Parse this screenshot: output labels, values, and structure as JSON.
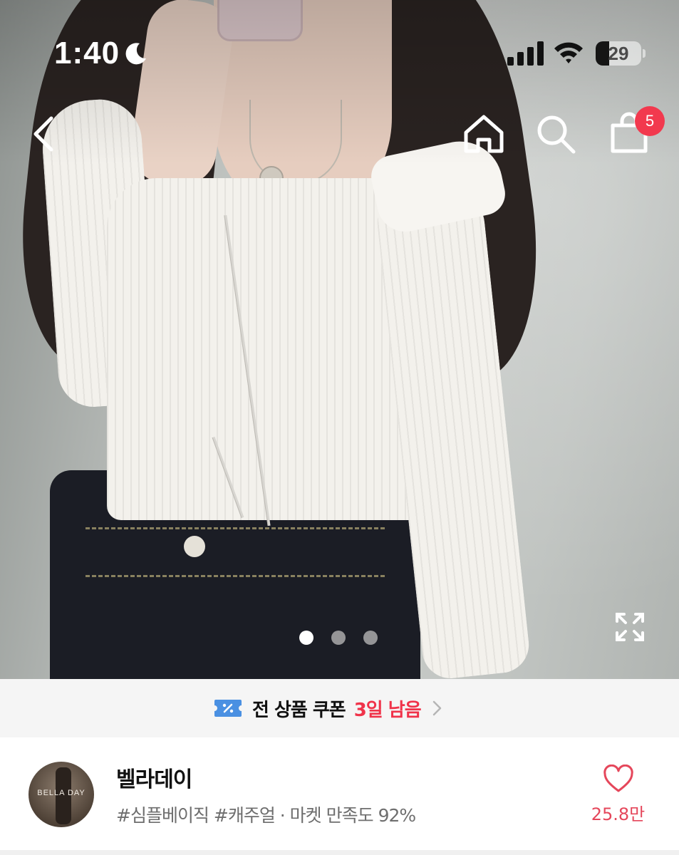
{
  "status_bar": {
    "time": "1:40",
    "battery_level": "29",
    "battery_fraction": 0.29,
    "icons": [
      "moon-icon",
      "signal-icon",
      "wifi-icon",
      "battery-icon"
    ]
  },
  "nav": {
    "icons": [
      "back-arrow-icon",
      "home-icon",
      "search-icon",
      "shopping-bag-icon"
    ],
    "cart_count": "5"
  },
  "gallery": {
    "total_images": 3,
    "active_index": 0,
    "icons": [
      "expand-icon"
    ]
  },
  "coupon": {
    "icon": "coupon-ticket-icon",
    "text": "전 상품 쿠폰",
    "days_left": "3일 남음"
  },
  "shop": {
    "avatar_text": "BELLA DAY",
    "name": "벨라데이",
    "tags": "#심플베이직 #캐주얼 · 마켓 만족도 92%",
    "likes": "25.8만"
  },
  "colors": {
    "accent": "#f0334a",
    "badge": "#f2394e",
    "like": "#e5475b",
    "coupon_bg": "#f5f5f5"
  }
}
